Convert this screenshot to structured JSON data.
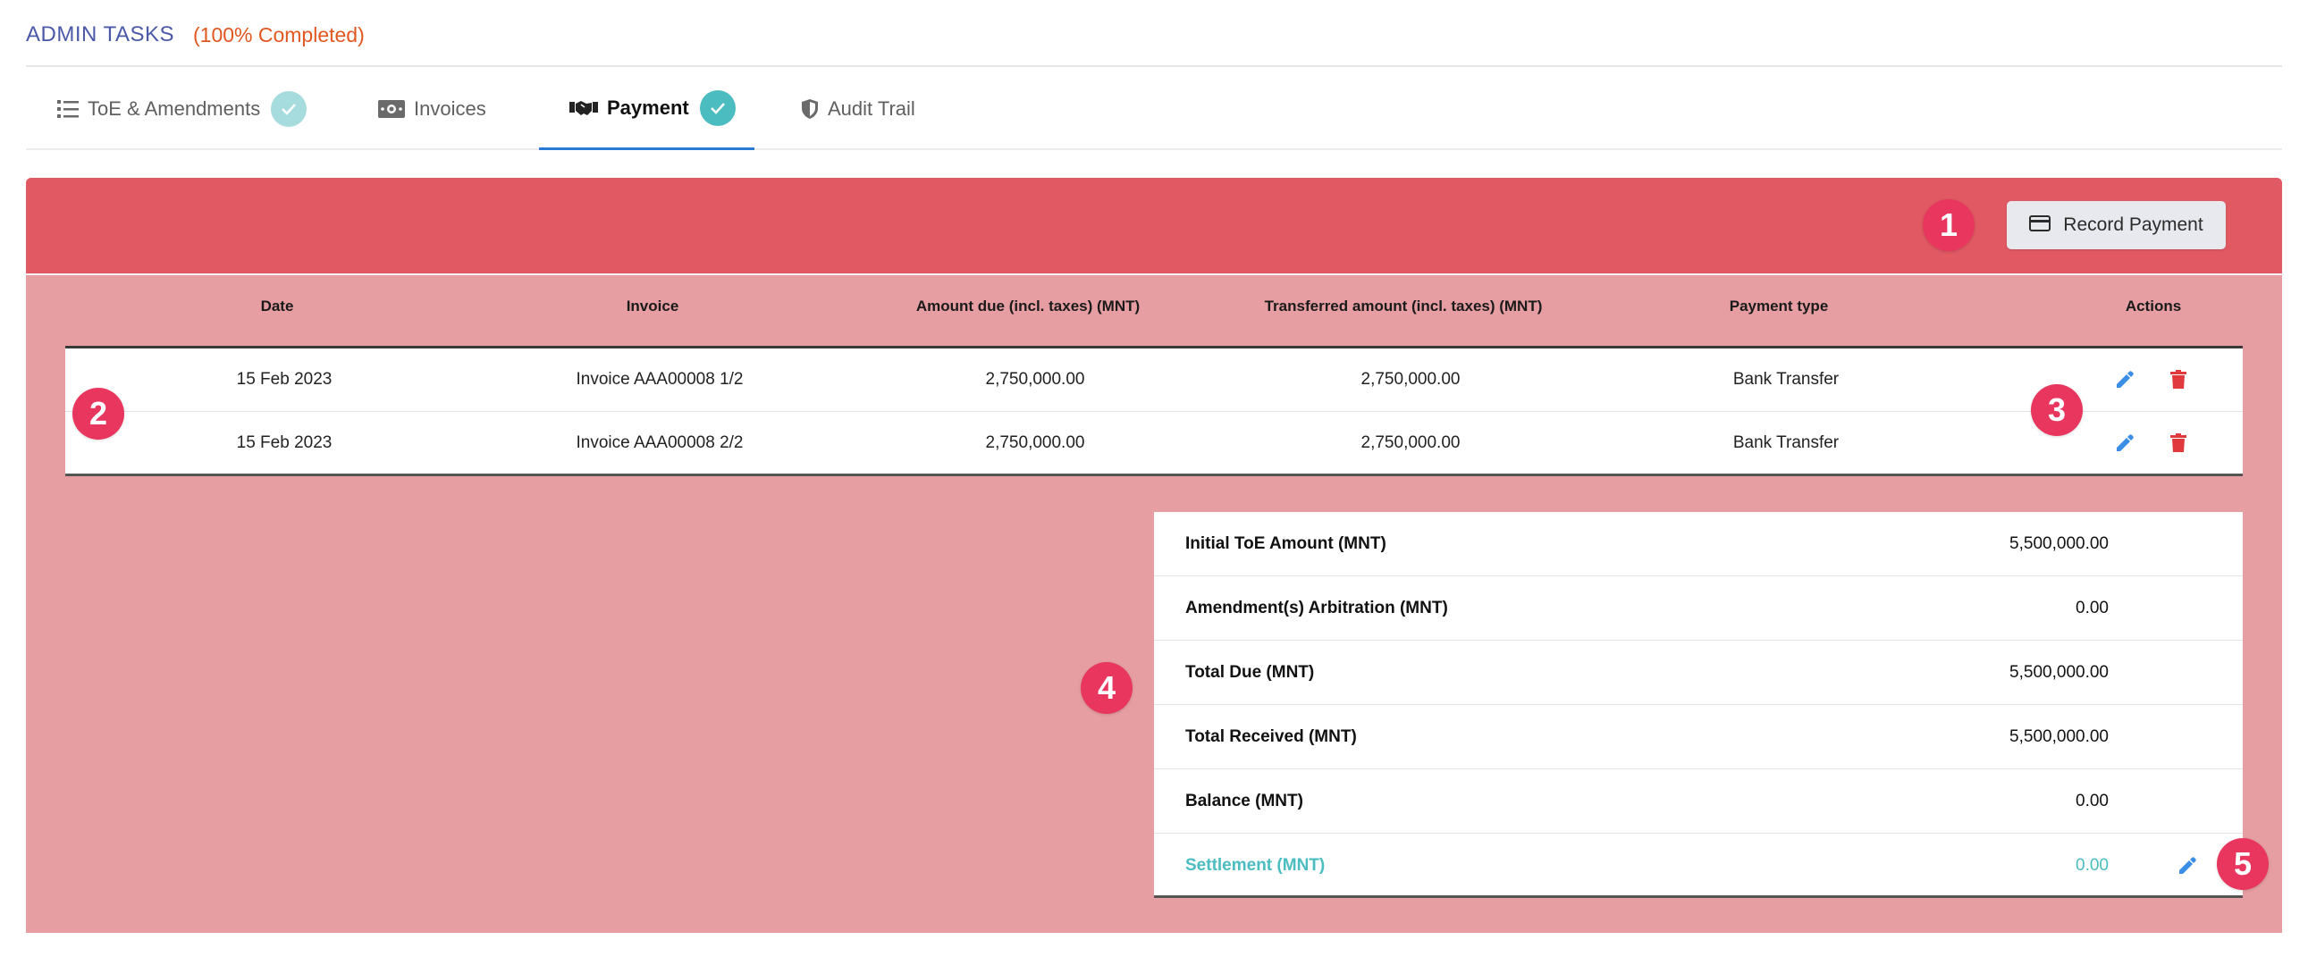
{
  "header": {
    "title": "ADMIN TASKS",
    "status": "(100% Completed)"
  },
  "tabs": [
    {
      "label": "ToE & Amendments",
      "icon": "list-icon",
      "completed": true,
      "active": false
    },
    {
      "label": "Invoices",
      "icon": "money-bill-icon",
      "completed": false,
      "active": false
    },
    {
      "label": "Payment",
      "icon": "handshake-icon",
      "completed": true,
      "active": true
    },
    {
      "label": "Audit Trail",
      "icon": "shield-icon",
      "completed": false,
      "active": false
    }
  ],
  "toolbar": {
    "record_payment_label": "Record Payment"
  },
  "table": {
    "columns": [
      "Date",
      "Invoice",
      "Amount due (incl. taxes) (MNT)",
      "Transferred amount (incl. taxes) (MNT)",
      "Payment type",
      "Actions"
    ],
    "rows": [
      {
        "date": "15 Feb 2023",
        "invoice": "Invoice AAA00008 1/2",
        "amount_due": "2,750,000.00",
        "transferred": "2,750,000.00",
        "payment_type": "Bank Transfer"
      },
      {
        "date": "15 Feb 2023",
        "invoice": "Invoice AAA00008 2/2",
        "amount_due": "2,750,000.00",
        "transferred": "2,750,000.00",
        "payment_type": "Bank Transfer"
      }
    ]
  },
  "summary": [
    {
      "label": "Initial ToE Amount (MNT)",
      "value": "5,500,000.00"
    },
    {
      "label": "Amendment(s) Arbitration (MNT)",
      "value": "0.00"
    },
    {
      "label": "Total Due (MNT)",
      "value": "5,500,000.00"
    },
    {
      "label": "Total Received (MNT)",
      "value": "5,500,000.00"
    },
    {
      "label": "Balance (MNT)",
      "value": "0.00"
    },
    {
      "label": "Settlement (MNT)",
      "value": "0.00"
    }
  ],
  "markers": [
    "1",
    "2",
    "3",
    "4",
    "5"
  ],
  "colors": {
    "accent_blue": "#2a7bd6",
    "header_title": "#4a59a8",
    "status_orange": "#e2561f",
    "panel_top": "#e15963",
    "panel_body": "#e69ea3",
    "badge_teal": "#4bbdc0",
    "marker_pink": "#e8365f",
    "delete_red": "#e0393e"
  }
}
